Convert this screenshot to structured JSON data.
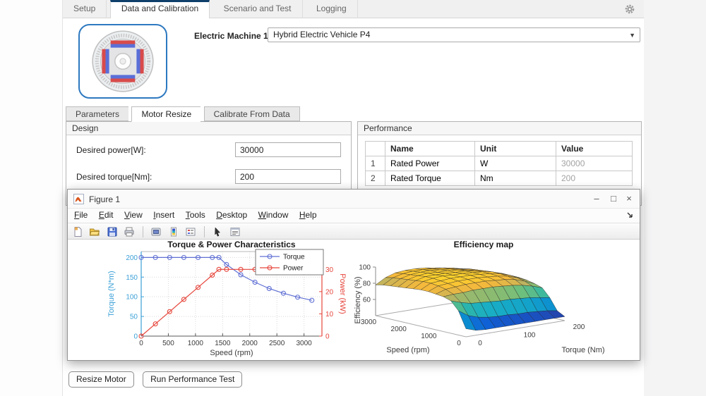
{
  "app": {
    "tabs": [
      {
        "label": "Setup",
        "active": false
      },
      {
        "label": "Data and Calibration",
        "active": true
      },
      {
        "label": "Scenario and Test",
        "active": false
      },
      {
        "label": "Logging",
        "active": false
      }
    ]
  },
  "machine": {
    "label": "Electric Machine 1:",
    "selected": "Hybrid Electric Vehicle P4"
  },
  "subtabs": [
    {
      "label": "Parameters",
      "active": false
    },
    {
      "label": "Motor Resize",
      "active": true
    },
    {
      "label": "Calibrate From Data",
      "active": false
    }
  ],
  "design": {
    "title": "Design",
    "fields": [
      {
        "label": "Desired power[W]:",
        "value": "30000"
      },
      {
        "label": "Desired torque[Nm]:",
        "value": "200"
      }
    ]
  },
  "performance": {
    "title": "Performance",
    "columns": {
      "name": "Name",
      "unit": "Unit",
      "value": "Value"
    },
    "rows": [
      {
        "num": "1",
        "name": "Rated Power",
        "unit": "W",
        "value": "30000"
      },
      {
        "num": "2",
        "name": "Rated Torque",
        "unit": "Nm",
        "value": "200"
      }
    ]
  },
  "figure_window": {
    "title": "Figure 1",
    "menu": [
      "File",
      "Edit",
      "View",
      "Insert",
      "Tools",
      "Desktop",
      "Window",
      "Help"
    ],
    "toolbar_icons": [
      "new-file-icon",
      "open-file-icon",
      "save-icon",
      "print-icon",
      "link-plot-icon",
      "colorbar-icon",
      "insert-legend-icon",
      "pointer-icon",
      "property-editor-icon"
    ],
    "controls": {
      "minimize": "–",
      "maximize": "□",
      "close": "×"
    }
  },
  "buttons": {
    "resize": "Resize Motor",
    "run": "Run Performance Test"
  },
  "icons": {
    "dropdown_arrow": "▼"
  },
  "colors": {
    "active_tab_border": "#0f3f6b",
    "torque_line": "#6070d4",
    "torque_axis": "#3ca0d7",
    "power_line": "#e6463c",
    "motor_border": "#2e79c0"
  },
  "chart_data": [
    {
      "type": "line",
      "title": "Torque & Power Characteristics",
      "xlabel": "Speed (rpm)",
      "xlim": [
        0,
        3330
      ],
      "x_ticks": [
        0,
        500,
        1000,
        1500,
        2000,
        2500,
        3000
      ],
      "y_left": {
        "label": "Torque (N*m)",
        "ticks": [
          0,
          50,
          100,
          150,
          200
        ],
        "lim": [
          0,
          215
        ],
        "color": "#3ca0d7"
      },
      "y_right": {
        "label": "Power (kW)",
        "ticks": [
          0,
          10,
          20,
          30
        ],
        "lim": [
          0,
          38
        ],
        "color": "#e6463c"
      },
      "x": [
        0,
        262,
        524,
        786,
        1048,
        1310,
        1432,
        1572,
        1834,
        2096,
        2358,
        2620,
        2882,
        3144
      ],
      "series": [
        {
          "name": "Torque",
          "axis": "left",
          "color": "#6070d4",
          "marker": "circle",
          "values": [
            200,
            200,
            200,
            200,
            200,
            200,
            200,
            182,
            156,
            137,
            121,
            109,
            99,
            91
          ]
        },
        {
          "name": "Power",
          "axis": "right",
          "color": "#e6463c",
          "marker": "circle",
          "values": [
            0,
            5.5,
            11,
            16.5,
            21.9,
            27.4,
            30,
            30,
            30,
            30,
            30,
            30,
            30,
            30
          ]
        }
      ],
      "legend": {
        "position": "top-right",
        "entries": [
          "Torque",
          "Power"
        ]
      },
      "grid": true
    },
    {
      "type": "surface",
      "title": "Efficiency map",
      "xlabel": "Torque (Nm)",
      "ylabel": "Speed (rpm)",
      "zlabel": "Efficiency (%)",
      "x_ticks": [
        0,
        100,
        200
      ],
      "y_ticks": [
        0,
        1000,
        2000,
        3000
      ],
      "z_ticks": [
        60,
        80,
        100
      ],
      "zlim": [
        40,
        100
      ],
      "colormap": "parula",
      "torque": [
        0,
        20,
        40,
        60,
        80,
        100,
        120,
        140,
        160,
        180,
        200
      ],
      "speed": [
        0,
        250,
        500,
        750,
        1000,
        1250,
        1500,
        1750,
        2000,
        2250,
        2500,
        2750,
        3000
      ],
      "efficiency": [
        [
          50,
          46,
          45,
          45,
          45,
          45,
          45,
          45,
          45,
          45,
          45
        ],
        [
          70,
          62,
          58,
          56,
          55,
          55,
          54,
          54,
          53,
          52,
          50
        ],
        [
          80,
          76,
          73,
          72,
          71,
          70,
          70,
          69,
          68,
          66,
          64
        ],
        [
          83,
          84,
          84,
          85,
          85,
          85,
          84,
          83,
          81,
          78,
          74
        ],
        [
          84,
          88,
          89,
          90,
          90,
          90,
          89,
          88,
          86,
          82,
          77
        ],
        [
          85,
          90,
          91,
          92,
          92,
          92,
          91,
          90,
          88,
          84,
          79
        ],
        [
          85,
          91,
          92,
          93,
          93,
          93,
          92,
          91,
          89,
          85,
          80
        ],
        [
          84,
          91,
          93,
          94,
          93,
          93,
          92,
          91,
          89,
          85,
          80
        ],
        [
          83,
          90,
          93,
          93,
          93,
          92,
          92,
          90,
          88,
          84,
          79
        ],
        [
          82,
          89,
          92,
          93,
          92,
          92,
          91,
          89,
          87,
          83,
          78
        ],
        [
          81,
          88,
          91,
          92,
          92,
          91,
          90,
          88,
          86,
          81,
          76
        ],
        [
          80,
          87,
          90,
          91,
          91,
          90,
          89,
          87,
          84,
          79,
          73
        ],
        [
          78,
          85,
          89,
          90,
          90,
          89,
          87,
          85,
          82,
          76,
          70
        ]
      ]
    }
  ]
}
